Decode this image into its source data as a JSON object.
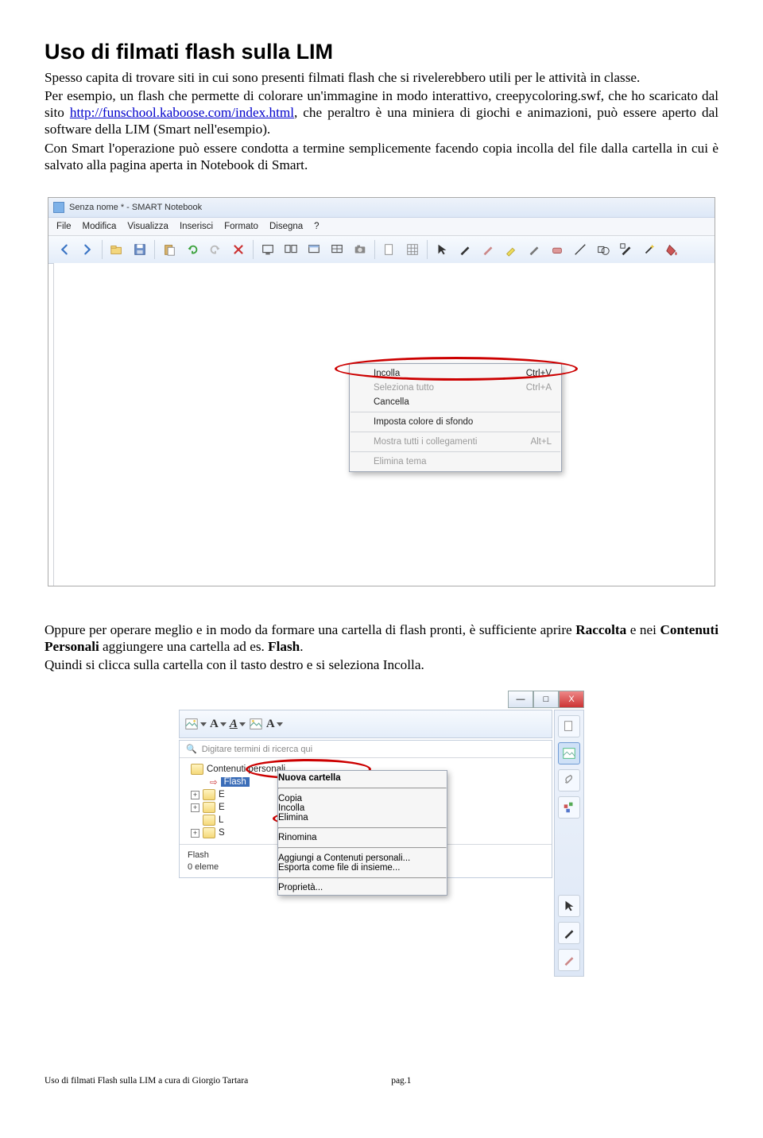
{
  "title": "Uso di filmati flash sulla LIM",
  "para1_a": "Spesso capita di trovare siti in cui sono presenti filmati flash che si rivelerebbero utili per le attività in classe.",
  "para2_a": "Per esempio, un flash che permette di colorare un'immagine in modo interattivo, creepycoloring.swf, che ho scaricato dal sito ",
  "link1": "http://funschool.kaboose.com/index.html",
  "para2_b": ", che peraltro è una miniera di giochi e animazioni, può essere aperto dal software della LIM (Smart nell'esempio).",
  "para3": "Con Smart l'operazione può essere condotta a termine semplicemente facendo copia incolla del file dalla cartella in cui è salvato alla pagina aperta in Notebook di Smart.",
  "shot1": {
    "title": "Senza nome * - SMART Notebook",
    "menu": [
      "File",
      "Modifica",
      "Visualizza",
      "Inserisci",
      "Formato",
      "Disegna",
      "?"
    ],
    "ctx": [
      {
        "label": "Incolla",
        "shortcut": "Ctrl+V",
        "disabled": false
      },
      {
        "label": "Seleziona tutto",
        "shortcut": "Ctrl+A",
        "disabled": true,
        "hr": false
      },
      {
        "label": "Cancella",
        "shortcut": "",
        "disabled": false,
        "hr": false
      },
      {
        "hr": true
      },
      {
        "label": "Imposta colore di sfondo",
        "shortcut": "",
        "disabled": false
      },
      {
        "hr": true
      },
      {
        "label": "Mostra tutti i collegamenti",
        "shortcut": "Alt+L",
        "disabled": true
      },
      {
        "hr": true
      },
      {
        "label": "Elimina tema",
        "shortcut": "",
        "disabled": true
      }
    ]
  },
  "para4_a": "Oppure per operare meglio e in modo da formare una cartella di flash pronti, è sufficiente aprire ",
  "para4_b1": "Raccolta",
  "para4_c": " e nei ",
  "para4_b2": "Contenuti Personali",
  "para4_d": " aggiungere una cartella ad es. ",
  "para4_b3": "Flash",
  "para4_e": ".",
  "para5": "Quindi si clicca sulla cartella con il tasto destro e si seleziona Incolla.",
  "shot2": {
    "win": {
      "min": "—",
      "max": "□",
      "close": "X"
    },
    "strip_A": "A",
    "search_placeholder": "Digitare termini di ricerca qui",
    "tree": {
      "root": "Contenuti personali",
      "flash": "Flash",
      "e": "E",
      "e2": "E",
      "l": "L",
      "s": "S"
    },
    "info_l1": "Flash",
    "info_l2": "0 eleme",
    "ctx": [
      {
        "label": "Nuova cartella",
        "bold": true
      },
      {
        "hr": true
      },
      {
        "label": "Copia",
        "disabled": true
      },
      {
        "label": "Incolla"
      },
      {
        "label": "Elimina"
      },
      {
        "hr": true
      },
      {
        "label": "Rinomina"
      },
      {
        "hr": true
      },
      {
        "label": "Aggiungi a Contenuti personali..."
      },
      {
        "label": "Esporta come file di insieme..."
      },
      {
        "hr": true
      },
      {
        "label": "Proprietà..."
      }
    ]
  },
  "footer_left": "Uso di filmati Flash sulla LIM a cura di Giorgio Tartara",
  "footer_right": "pag.1"
}
